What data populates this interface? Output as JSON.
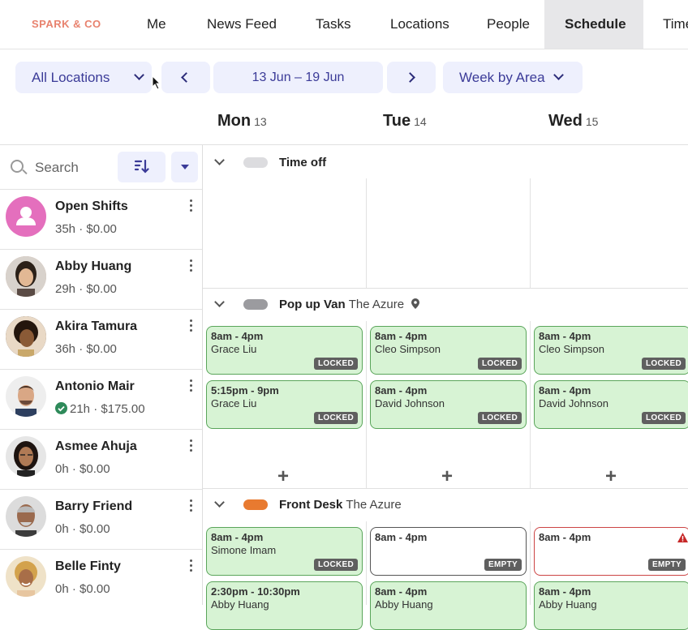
{
  "nav": {
    "logo": "SPARK & CO",
    "items": [
      "Me",
      "News Feed",
      "Tasks",
      "Locations",
      "People",
      "Schedule",
      "Time"
    ]
  },
  "toolbar": {
    "location_filter": "All Locations",
    "date_range": "13 Jun – 19 Jun",
    "view": "Week by Area"
  },
  "days": [
    {
      "name": "Mon",
      "num": "13"
    },
    {
      "name": "Tue",
      "num": "14"
    },
    {
      "name": "Wed",
      "num": "15"
    }
  ],
  "search": {
    "placeholder": "Search"
  },
  "people": [
    {
      "name": "Open Shifts",
      "stats": "35h · $0.00"
    },
    {
      "name": "Abby Huang",
      "stats": "29h · $0.00"
    },
    {
      "name": "Akira Tamura",
      "stats": "36h · $0.00"
    },
    {
      "name": "Antonio Mair",
      "stats": "21h · $175.00"
    },
    {
      "name": "Asmee Ahuja",
      "stats": "0h · $0.00"
    },
    {
      "name": "Barry Friend",
      "stats": "0h · $0.00"
    },
    {
      "name": "Belle Finty",
      "stats": "0h · $0.00"
    }
  ],
  "areas": [
    {
      "name": "Time off",
      "location": ""
    },
    {
      "name": "Pop up Van",
      "location": "The Azure"
    },
    {
      "name": "Front Desk",
      "location": "The Azure"
    }
  ],
  "shifts": {
    "popup": [
      [
        {
          "time": "8am - 4pm",
          "who": "Grace Liu",
          "badge": "LOCKED"
        },
        {
          "time": "5:15pm - 9pm",
          "who": "Grace Liu",
          "badge": "LOCKED"
        }
      ],
      [
        {
          "time": "8am - 4pm",
          "who": "Cleo Simpson",
          "badge": "LOCKED"
        },
        {
          "time": "8am - 4pm",
          "who": "David Johnson",
          "badge": "LOCKED"
        }
      ],
      [
        {
          "time": "8am - 4pm",
          "who": "Cleo Simpson",
          "badge": "LOCKED"
        },
        {
          "time": "8am - 4pm",
          "who": "David Johnson",
          "badge": "LOCKED"
        }
      ]
    ],
    "frontdesk": [
      [
        {
          "time": "8am - 4pm",
          "who": "Simone Imam",
          "badge": "LOCKED"
        },
        {
          "time": "2:30pm - 10:30pm",
          "who": "Abby Huang",
          "badge": ""
        }
      ],
      [
        {
          "time": "8am - 4pm",
          "who": "",
          "badge": "EMPTY"
        },
        {
          "time": "8am - 4pm",
          "who": "Abby Huang",
          "badge": ""
        }
      ],
      [
        {
          "time": "8am - 4pm",
          "who": "",
          "badge": "EMPTY"
        },
        {
          "time": "8am - 4pm",
          "who": "Abby Huang",
          "badge": ""
        }
      ]
    ]
  },
  "colors": {
    "accent": "#3b3b98",
    "shift_green": "#d7f3d4",
    "pill_timeoff": "#dcdcdf",
    "pill_popup": "#9b9b9f",
    "pill_frontdesk": "#e87a30"
  }
}
